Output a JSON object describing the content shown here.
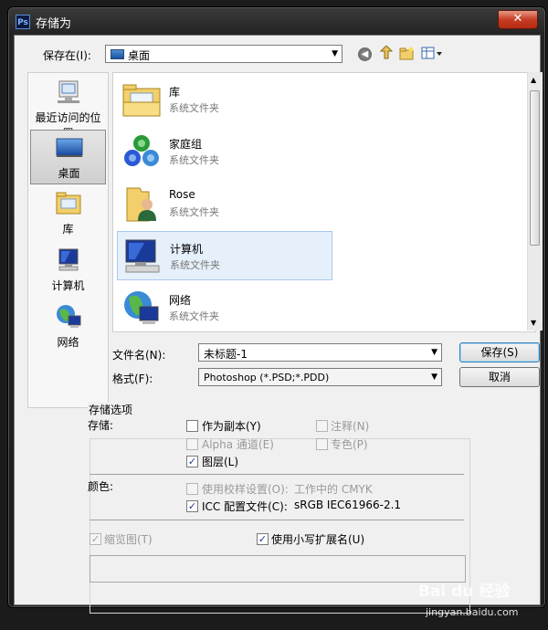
{
  "window": {
    "title": "存储为",
    "app_icon": "Ps",
    "close_label": "✕"
  },
  "toolbar": {
    "save_in_label": "保存在(I):",
    "location": "桌面"
  },
  "places": [
    {
      "label": "最近访问的位置",
      "icon": "recent-places-icon"
    },
    {
      "label": "桌面",
      "icon": "desktop-icon"
    },
    {
      "label": "库",
      "icon": "libraries-icon"
    },
    {
      "label": "计算机",
      "icon": "computer-icon"
    },
    {
      "label": "网络",
      "icon": "network-icon"
    }
  ],
  "files": [
    {
      "name": "库",
      "type": "系统文件夹"
    },
    {
      "name": "家庭组",
      "type": "系统文件夹"
    },
    {
      "name": "Rose",
      "type": "系统文件夹"
    },
    {
      "name": "计算机",
      "type": "系统文件夹"
    },
    {
      "name": "网络",
      "type": "系统文件夹"
    }
  ],
  "form": {
    "filename_label": "文件名(N):",
    "filename_value": "未标题-1",
    "format_label": "格式(F):",
    "format_value": "Photoshop (*.PSD;*.PDD)",
    "save_button": "保存(S)",
    "cancel_button": "取消"
  },
  "options": {
    "group_title": "存储选项",
    "store_label": "存储:",
    "as_copy": "作为副本(Y)",
    "notes": "注释(N)",
    "alpha": "Alpha 通道(E)",
    "spot": "专色(P)",
    "layers": "图层(L)",
    "color_label": "颜色:",
    "proof": "使用校样设置(O):",
    "proof_value": "工作中的 CMYK",
    "icc": "ICC 配置文件(C):",
    "icc_value": "sRGB IEC61966-2.1",
    "thumbnail": "缩览图(T)",
    "lowercase": "使用小写扩展名(U)"
  },
  "watermark": {
    "text": "Bai du 经验",
    "url": "jingyan.baidu.com"
  },
  "colors": {
    "close": "#c63d24",
    "selection": "#e6f0fb",
    "default_button_border": "#3c7fb1"
  }
}
